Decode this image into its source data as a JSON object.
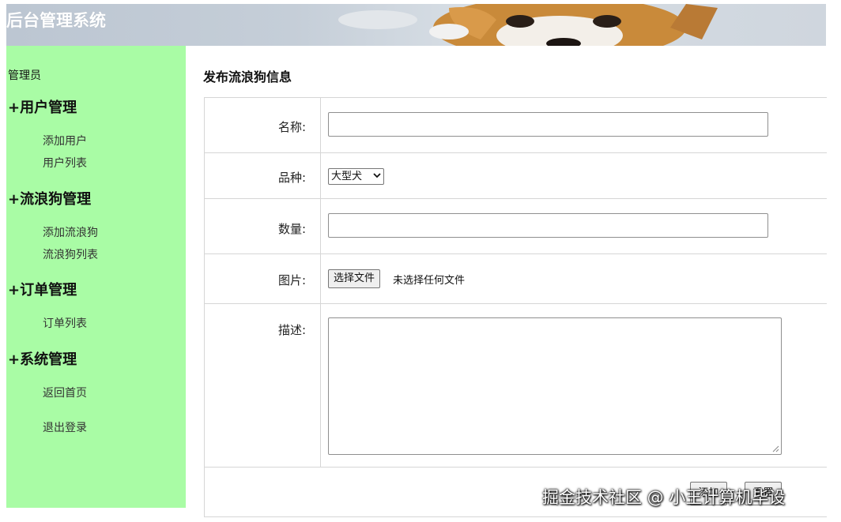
{
  "header": {
    "title": "后台管理系统"
  },
  "sidebar": {
    "role": "管理员",
    "groups": [
      {
        "title": "+用户管理",
        "items": [
          "添加用户",
          "用户列表"
        ]
      },
      {
        "title": "+流浪狗管理",
        "items": [
          "添加流浪狗",
          "流浪狗列表"
        ]
      },
      {
        "title": "+订单管理",
        "items": [
          "订单列表"
        ]
      },
      {
        "title": "+系统管理",
        "items": [
          "返回首页",
          "退出登录"
        ]
      }
    ]
  },
  "main": {
    "title": "发布流浪狗信息",
    "form": {
      "name_label": "名称:",
      "name_value": "",
      "breed_label": "品种:",
      "breed_selected": "大型犬",
      "quantity_label": "数量:",
      "quantity_value": "",
      "image_label": "图片:",
      "file_button": "选择文件",
      "file_status": "未选择任何文件",
      "desc_label": "描述:",
      "desc_value": "",
      "submit_label": "添加",
      "reset_label": "重置"
    }
  },
  "watermark": "掘金技术社区 @ 小王计算机毕设",
  "colors": {
    "sidebar_bg": "#a9fca5",
    "border": "#d6d6d6"
  }
}
